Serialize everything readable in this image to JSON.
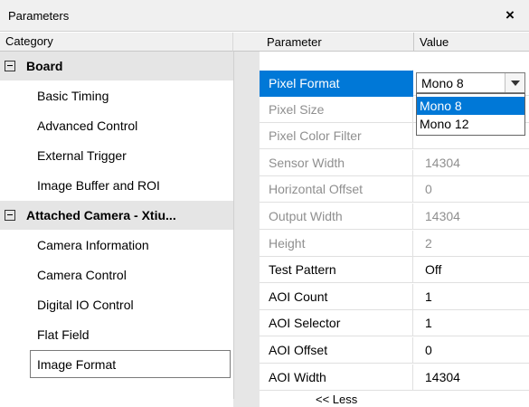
{
  "window": {
    "title": "Parameters",
    "close_glyph": "×"
  },
  "category": {
    "header": "Category",
    "items": [
      {
        "label": "Board",
        "type": "group"
      },
      {
        "label": "Basic Timing",
        "type": "child"
      },
      {
        "label": "Advanced Control",
        "type": "child"
      },
      {
        "label": "External Trigger",
        "type": "child"
      },
      {
        "label": "Image Buffer and ROI",
        "type": "child"
      },
      {
        "label": "Attached Camera - Xtiu...",
        "type": "group"
      },
      {
        "label": "Camera Information",
        "type": "child"
      },
      {
        "label": "Camera Control",
        "type": "child"
      },
      {
        "label": "Digital IO Control",
        "type": "child"
      },
      {
        "label": "Flat Field",
        "type": "child"
      },
      {
        "label": "Image Format",
        "type": "child",
        "selected": true
      }
    ]
  },
  "grid": {
    "header_parameter": "Parameter",
    "header_value": "Value",
    "rows": [
      {
        "name": "Pixel Format",
        "value": "Mono 8",
        "state": "active"
      },
      {
        "name": "Pixel Size",
        "value": "",
        "state": "disabled"
      },
      {
        "name": "Pixel Color Filter",
        "value": "",
        "state": "disabled"
      },
      {
        "name": "Sensor Width",
        "value": "14304",
        "state": "disabled"
      },
      {
        "name": "Horizontal Offset",
        "value": "0",
        "state": "disabled"
      },
      {
        "name": "Output Width",
        "value": "14304",
        "state": "disabled"
      },
      {
        "name": "Height",
        "value": "2",
        "state": "disabled"
      },
      {
        "name": "Test Pattern",
        "value": "Off",
        "state": "enabled"
      },
      {
        "name": "AOI Count",
        "value": "1",
        "state": "enabled"
      },
      {
        "name": "AOI Selector",
        "value": "1",
        "state": "enabled"
      },
      {
        "name": "AOI Offset",
        "value": "0",
        "state": "enabled"
      },
      {
        "name": "AOI Width",
        "value": "14304",
        "state": "enabled"
      }
    ],
    "less_link": "<< Less"
  },
  "pixel_format_combo": {
    "selected": "Mono 8",
    "options": [
      "Mono 8",
      "Mono 12"
    ]
  },
  "colors": {
    "selection": "#0078d7",
    "group_bg": "#e5e5e5",
    "disabled_text": "#8f8f8f"
  }
}
